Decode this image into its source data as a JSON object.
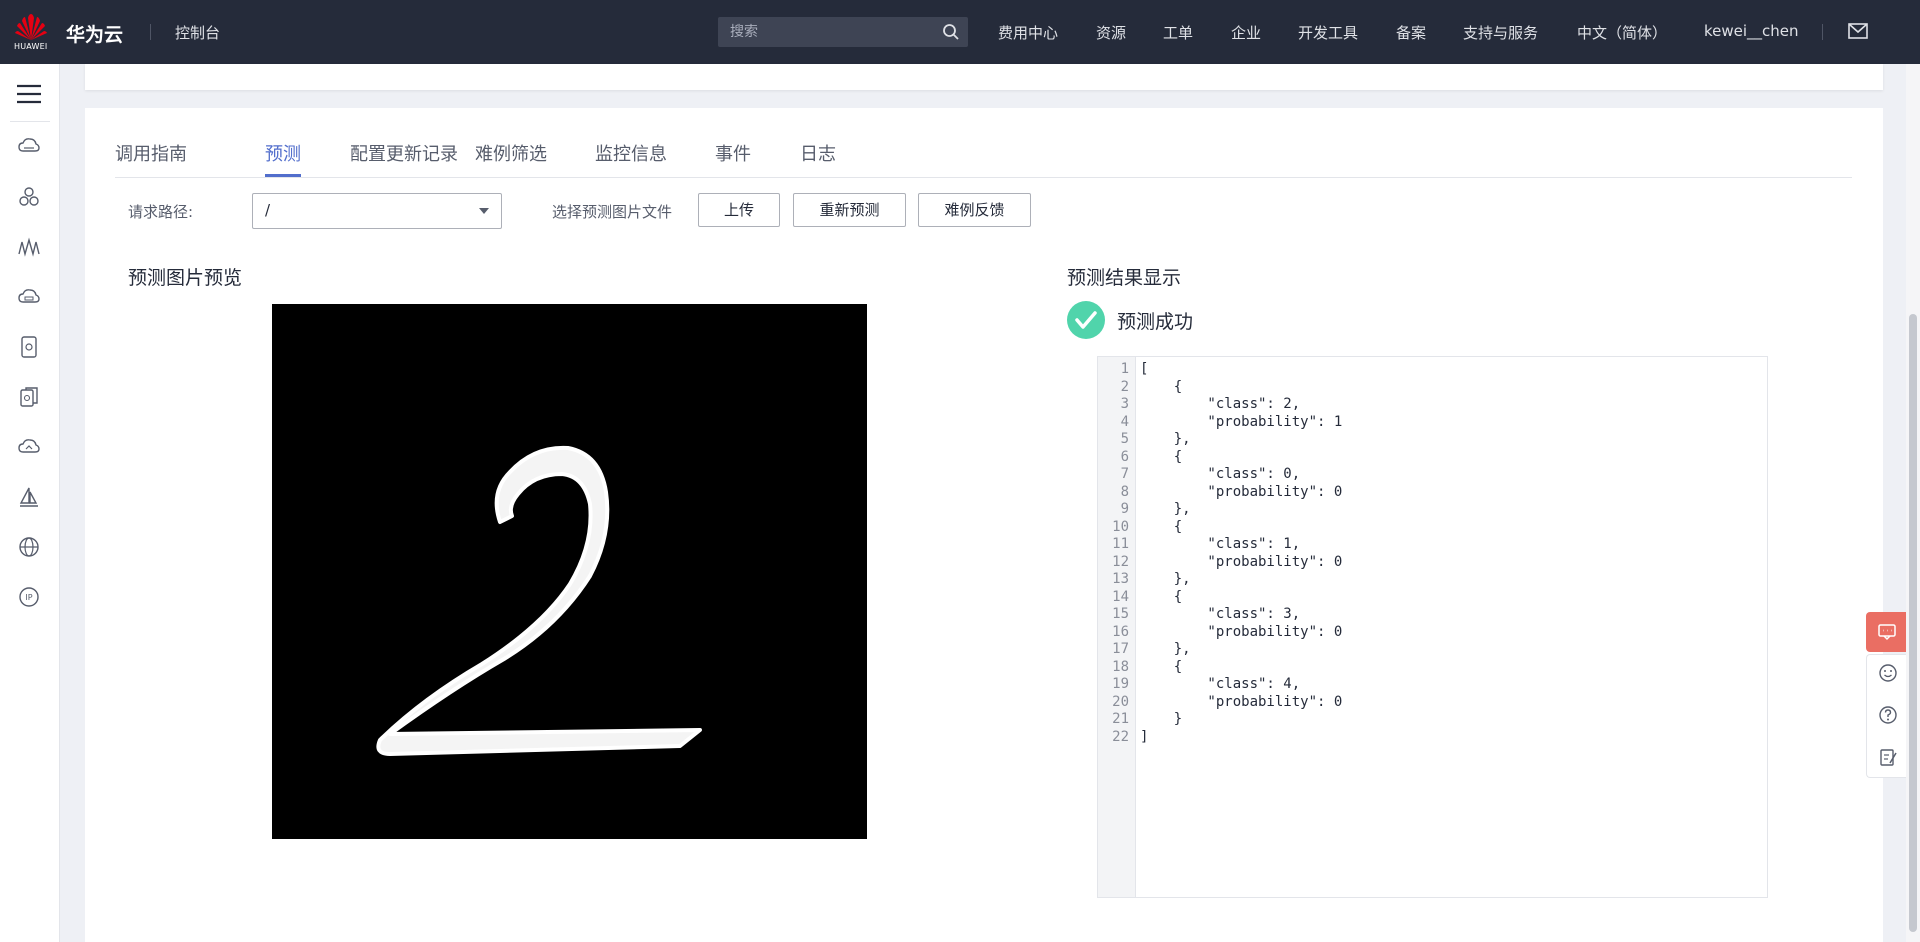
{
  "header": {
    "logo_text": "HUAWEI",
    "brand": "华为云",
    "console": "控制台",
    "search_placeholder": "搜索",
    "nav": [
      "费用中心",
      "资源",
      "工单",
      "企业",
      "开发工具",
      "备案",
      "支持与服务",
      "中文（简体）",
      "kewei__chen"
    ]
  },
  "sidebar": {
    "icons": [
      "menu-icon",
      "cloud-server-icon",
      "cluster-icon",
      "waveform-icon",
      "cloud-storage-icon",
      "container-icon",
      "documents-icon",
      "cloud-upload-icon",
      "sailboat-icon",
      "globe-icon",
      "ip-icon"
    ]
  },
  "tabs": [
    "调用指南",
    "预测",
    "配置更新记录",
    "难例筛选",
    "监控信息",
    "事件",
    "日志"
  ],
  "active_tab": "预测",
  "request": {
    "path_label": "请求路径:",
    "path_value": "/",
    "file_label": "选择预测图片文件",
    "upload": "上传",
    "repredict": "重新预测",
    "feedback": "难例反馈"
  },
  "preview_title": "预测图片预览",
  "result_title": "预测结果显示",
  "result_status": "预测成功",
  "code_lines": [
    "[",
    "    {",
    "        \"class\": 2,",
    "        \"probability\": 1",
    "    },",
    "    {",
    "        \"class\": 0,",
    "        \"probability\": 0",
    "    },",
    "    {",
    "        \"class\": 1,",
    "        \"probability\": 0",
    "    },",
    "    {",
    "        \"class\": 3,",
    "        \"probability\": 0",
    "    },",
    "    {",
    "        \"class\": 4,",
    "        \"probability\": 0",
    "    }",
    "]"
  ],
  "colors": {
    "topbar": "#252b3a",
    "accent": "#526ecc",
    "success": "#50d4ab",
    "chat": "#ea6e63"
  }
}
